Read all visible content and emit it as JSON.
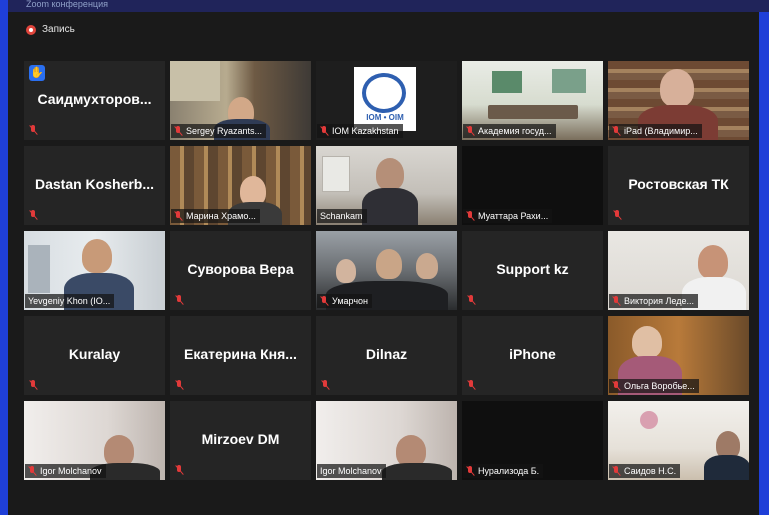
{
  "window_top_text": "Zoom конференция",
  "recording": {
    "label": "Запись"
  },
  "tiles": [
    {
      "name": "Саидмухторов...",
      "display": "big",
      "muted": true,
      "raised_hand": true
    },
    {
      "name": "Sergey Ryazants...",
      "display": "video",
      "muted": true
    },
    {
      "name": "IOM Kazakhstan",
      "display": "video",
      "muted": true,
      "logo_text": "IOM • OIM"
    },
    {
      "name": "Академия госуд...",
      "display": "video",
      "muted": true
    },
    {
      "name": "iPad (Владимир...",
      "display": "video",
      "muted": true
    },
    {
      "name": "Dastan Kosherb...",
      "display": "big",
      "muted": true
    },
    {
      "name": "Марина Храмо...",
      "display": "video",
      "muted": true
    },
    {
      "name": "Schankam",
      "display": "video",
      "muted": false,
      "active_speaker": true
    },
    {
      "name": "Муаттара Рахи...",
      "display": "video",
      "muted": true
    },
    {
      "name": "Ростовская ТК",
      "display": "big",
      "muted": true
    },
    {
      "name": "Yevgeniy Khon (IO...",
      "display": "video",
      "muted": false
    },
    {
      "name": "Суворова Вера",
      "display": "big",
      "muted": true
    },
    {
      "name": "Умарчон",
      "display": "video",
      "muted": true
    },
    {
      "name": "Support kz",
      "display": "big",
      "muted": true
    },
    {
      "name": "Виктория Леде...",
      "display": "video",
      "muted": true
    },
    {
      "name": "Kuralay",
      "display": "big",
      "muted": true
    },
    {
      "name": "Екатерина Кня...",
      "display": "big",
      "muted": true
    },
    {
      "name": "Dilnaz",
      "display": "big",
      "muted": true
    },
    {
      "name": "iPhone",
      "display": "big",
      "muted": true
    },
    {
      "name": "Ольга Воробье...",
      "display": "video",
      "muted": true
    },
    {
      "name": "Igor Molchanov",
      "display": "video",
      "muted": true
    },
    {
      "name": "Mirzoev DM",
      "display": "big",
      "muted": true
    },
    {
      "name": "Igor Molchanov",
      "display": "video",
      "muted": false
    },
    {
      "name": "Нурализода Б.",
      "display": "video",
      "muted": true
    },
    {
      "name": "Саидов Н.С.",
      "display": "video",
      "muted": true
    }
  ]
}
